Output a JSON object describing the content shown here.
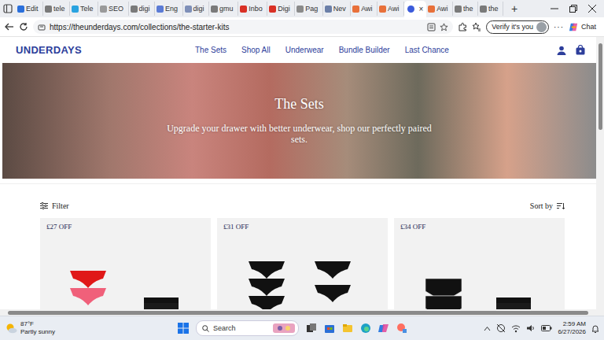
{
  "browser": {
    "tabs": [
      {
        "label": "Edit",
        "selected": false
      },
      {
        "label": "tele",
        "selected": false
      },
      {
        "label": "Tele",
        "selected": false
      },
      {
        "label": "SEO",
        "selected": false
      },
      {
        "label": "digi",
        "selected": false
      },
      {
        "label": "Eng",
        "selected": false
      },
      {
        "label": "digi",
        "selected": false
      },
      {
        "label": "gmu",
        "selected": false
      },
      {
        "label": "Inbo",
        "selected": false
      },
      {
        "label": "Digi",
        "selected": false
      },
      {
        "label": "Pag",
        "selected": false
      },
      {
        "label": "Nev",
        "selected": false
      },
      {
        "label": "Awi",
        "selected": false
      },
      {
        "label": "Awi",
        "selected": false
      },
      {
        "label": "×",
        "selected": true
      },
      {
        "label": "Awi",
        "selected": false
      },
      {
        "label": "the",
        "selected": false
      },
      {
        "label": "the",
        "selected": false
      }
    ],
    "new_tab": "+",
    "address": "https://theunderdays.com/collections/the-starter-kits",
    "profile_button": "Verify it's you",
    "more": "···",
    "chat": "Chat"
  },
  "site": {
    "logo": "UNDERDAYS",
    "nav": [
      "The Sets",
      "Shop All",
      "Underwear",
      "Bundle Builder",
      "Last Chance"
    ],
    "hero": {
      "title": "The Sets",
      "subtitle": "Upgrade your drawer with better underwear, shop our perfectly paired sets."
    },
    "filter": "Filter",
    "sort": "Sort by",
    "products": [
      {
        "badge": "£27 OFF"
      },
      {
        "badge": "£31 OFF"
      },
      {
        "badge": "£34 OFF"
      }
    ]
  },
  "taskbar": {
    "weather": {
      "temp": "87°F",
      "condition": "Partly sunny"
    },
    "search": "Search",
    "time": "2:59 AM",
    "date": "6/27/2026"
  }
}
